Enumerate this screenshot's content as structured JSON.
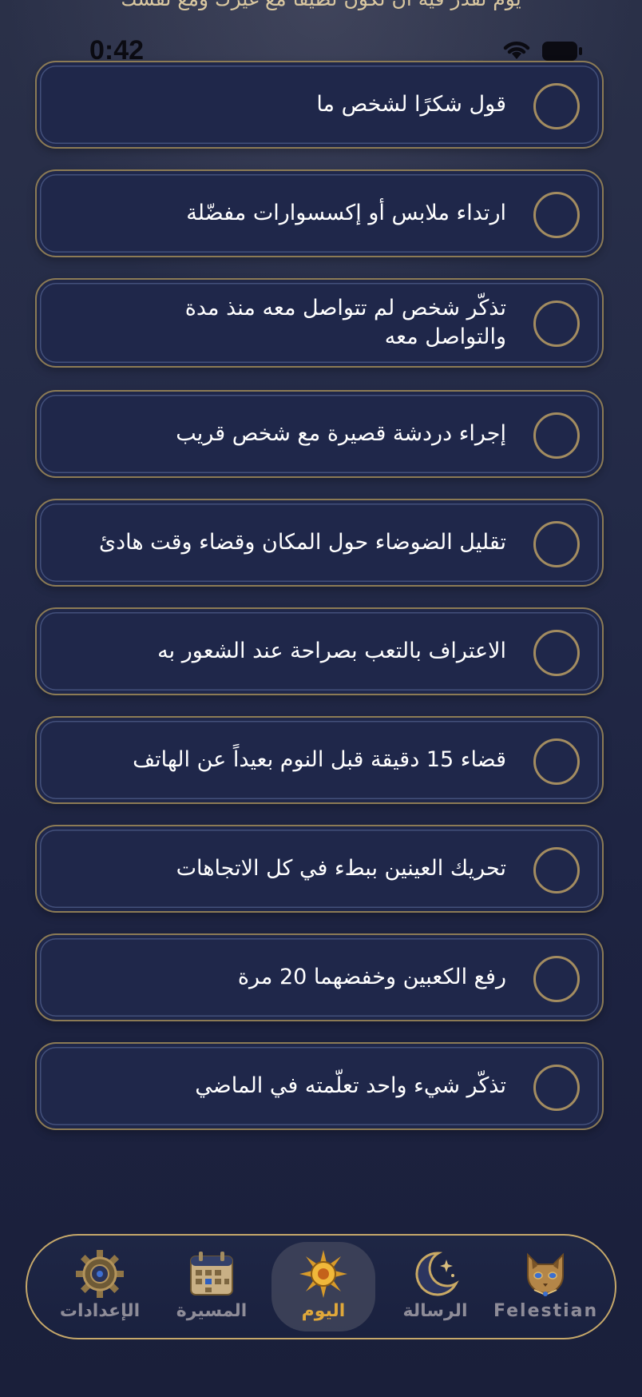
{
  "top_banner": "يوم تقدر فيه أن تكون لطيفا مع غيرك ومع نفسك",
  "status_bar": {
    "time": "0:42"
  },
  "tasks": [
    {
      "label": "قول شكرًا لشخص ما",
      "checked": false
    },
    {
      "label": "ارتداء ملابس أو إكسسوارات مفضّلة",
      "checked": false
    },
    {
      "label": "تذكّر شخص لم تتواصل معه منذ مدة والتواصل معه",
      "checked": false
    },
    {
      "label": "إجراء دردشة قصيرة مع شخص قريب",
      "checked": false
    },
    {
      "label": "تقليل الضوضاء حول المكان وقضاء وقت هادئ",
      "checked": false
    },
    {
      "label": "الاعتراف بالتعب بصراحة عند الشعور به",
      "checked": false
    },
    {
      "label": "قضاء 15 دقيقة قبل النوم بعيداً عن الهاتف",
      "checked": false
    },
    {
      "label": "تحريك العينين ببطء في كل الاتجاهات",
      "checked": false
    },
    {
      "label": "رفع الكعبين وخفضهما 20 مرة",
      "checked": false
    },
    {
      "label": "تذكّر شيء واحد تعلّمته في الماضي",
      "checked": false
    }
  ],
  "tab_bar": {
    "items": [
      {
        "label": "Felestian",
        "icon": "cat-icon",
        "active": false
      },
      {
        "label": "الرسالة",
        "icon": "moon-star-icon",
        "active": false
      },
      {
        "label": "اليوم",
        "icon": "sun-icon",
        "active": true
      },
      {
        "label": "المسيرة",
        "icon": "calendar-icon",
        "active": false
      },
      {
        "label": "الإعدادات",
        "icon": "gear-icon",
        "active": false
      }
    ]
  },
  "colors": {
    "accent_gold": "#c6a86a",
    "active_tab": "#e0a83a",
    "card_bg": "#1f274a",
    "background": "#1d2341"
  }
}
